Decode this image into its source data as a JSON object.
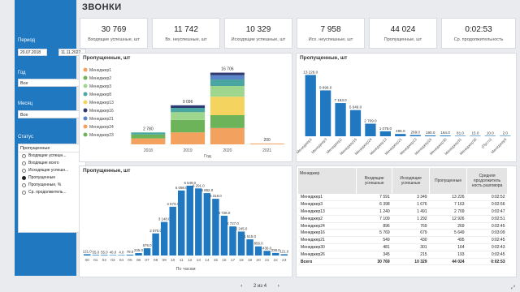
{
  "page": {
    "title": "ЗВОНКИ"
  },
  "sidebar": {
    "period_label": "Период",
    "date_from": "20.07.2018",
    "date_to": "11.11.2022",
    "year_label": "Год",
    "year_value": "Все",
    "month_label": "Месяц",
    "month_value": "Все",
    "status_label": "Статус",
    "status_value": "Пропущенные",
    "status_options": [
      {
        "label": "Входящие успешн...",
        "selected": false
      },
      {
        "label": "Входящие всего",
        "selected": false
      },
      {
        "label": "Исходящие успешн...",
        "selected": false
      },
      {
        "label": "Пропущенные",
        "selected": true
      },
      {
        "label": "Пропущенные, %",
        "selected": false
      },
      {
        "label": "Ср. продолжитель...",
        "selected": false
      }
    ]
  },
  "kpis": [
    {
      "value": "30 769",
      "label": "Входящие успешные, шт"
    },
    {
      "value": "11 742",
      "label": "Вх. неуспешные, шт"
    },
    {
      "value": "10 329",
      "label": "Исходящие успешные, шт"
    },
    {
      "value": "7 958",
      "label": "Исх. неуспешные, шт"
    },
    {
      "value": "44 024",
      "label": "Пропущенные, шт"
    },
    {
      "value": "0:02:53",
      "label": "Ср. продолжительность"
    }
  ],
  "panels": {
    "by_year_title": "Пропущенные, шт",
    "by_manager_title": "Пропущенные, шт",
    "by_hour_title": "Пропущенные, шт"
  },
  "chart_data": [
    {
      "type": "bar",
      "stacked": true,
      "categories": [
        "2018",
        "2019",
        "2020",
        "2021"
      ],
      "xlabel": "Год",
      "totals": [
        2780,
        9096,
        16706,
        200
      ],
      "legend": [
        "Менеджер1",
        "Менеджер2",
        "Менеджер3",
        "Менеджер8",
        "Менеджер13",
        "Менеджер16",
        "Менеджер21",
        "Менеджер24",
        "Менеджер23"
      ],
      "colors": {
        "orange": "#f2a25e",
        "green": "#6cb35a",
        "lightgreen": "#9ed68d",
        "teal": "#4aa6a0",
        "yellow": "#f4d35e",
        "navy": "#2f3a73",
        "blue": "#5a86c9"
      },
      "segments": {
        "2018": [
          {
            "color": "orange",
            "value": 1400
          },
          {
            "color": "green",
            "value": 900
          },
          {
            "color": "teal",
            "value": 480
          }
        ],
        "2019": [
          {
            "color": "orange",
            "value": 2800
          },
          {
            "color": "green",
            "value": 2900
          },
          {
            "color": "lightgreen",
            "value": 1800
          },
          {
            "color": "teal",
            "value": 1000
          },
          {
            "color": "navy",
            "value": 596
          }
        ],
        "2020": [
          {
            "color": "orange",
            "value": 3800
          },
          {
            "color": "green",
            "value": 3000
          },
          {
            "color": "yellow",
            "value": 4300
          },
          {
            "color": "lightgreen",
            "value": 2500
          },
          {
            "color": "teal",
            "value": 1500
          },
          {
            "color": "blue",
            "value": 1000
          },
          {
            "color": "navy",
            "value": 606
          }
        ],
        "2021": [
          {
            "color": "orange",
            "value": 200
          }
        ]
      }
    },
    {
      "type": "bar",
      "categories": [
        "Менеджер1",
        "Менеджер3",
        "Менеджер2",
        "Менеджер16",
        "Менеджер24",
        "Менеджер13",
        "Менеджер21",
        "Менеджер23",
        "Менеджер26",
        "Менеджер30",
        "Менеджер31",
        "Менеджер38",
        "(Пусто)",
        "Менеджер5"
      ],
      "values": [
        13226,
        9899,
        7163,
        5649,
        2709,
        1078,
        495,
        269,
        190,
        164,
        81,
        15,
        10,
        2
      ],
      "labels": [
        "13 226.0",
        "9 899.0",
        "7 163.0",
        "5 649.0",
        "2 709.0",
        "1 078.0",
        "495.0",
        "269.0",
        "190.0",
        "164.0",
        "81.0",
        "15.0",
        "10.0",
        "2.0"
      ],
      "ylim": [
        0,
        14000
      ]
    },
    {
      "type": "bar",
      "categories": [
        "00",
        "01",
        "02",
        "03",
        "04",
        "05",
        "06",
        "07",
        "08",
        "09",
        "10",
        "11",
        "12",
        "13",
        "14",
        "15",
        "16",
        "17",
        "18",
        "19",
        "20",
        "21",
        "22",
        "23"
      ],
      "values": [
        121,
        55,
        55,
        40,
        4,
        79,
        225,
        676,
        2070,
        3148,
        4573,
        6098,
        6549,
        6291,
        5852,
        5318,
        3728,
        2727,
        2245,
        1515,
        856,
        436,
        238,
        121
      ],
      "labels": [
        "121.0",
        "55.0",
        "55.0",
        "40.0",
        "4.0",
        "79.0",
        "225.0",
        "676.0",
        "2 070.0",
        "3 148.0",
        "4 573.0",
        "6 098.0",
        "6 549.0",
        "6 291.0",
        "5 852.0",
        "5 318.0",
        "3 728.0",
        "2 727.0",
        "2 245.0",
        "1 515.0",
        "856.0",
        "436.0",
        "238.0",
        "121.0"
      ],
      "xlabel": "По часам",
      "ylim": [
        0,
        7000
      ]
    }
  ],
  "table": {
    "headers": [
      "Менеджер",
      "Входящие успешные",
      "Исходящие успешные",
      "Пропущенные",
      "Средняя продолжитель ность разговора"
    ],
    "rows": [
      [
        "Менеджер1",
        "7 591",
        "3 349",
        "13 226",
        "0:02:52"
      ],
      [
        "Менеджер3",
        "6 398",
        "1 676",
        "7 163",
        "0:02:56"
      ],
      [
        "Менеджер13",
        "1 240",
        "1 491",
        "2 709",
        "0:02:47"
      ],
      [
        "Менеджер2",
        "7 109",
        "1 292",
        "12 926",
        "0:02:51"
      ],
      [
        "Менеджер24",
        "896",
        "769",
        "269",
        "0:02:45"
      ],
      [
        "Менеджер16",
        "5 769",
        "679",
        "5 649",
        "0:03:09"
      ],
      [
        "Менеджер21",
        "549",
        "430",
        "495",
        "0:02:45"
      ],
      [
        "Менеджер30",
        "481",
        "301",
        "164",
        "0:02:43"
      ],
      [
        "Менеджер26",
        "345",
        "215",
        "193",
        "0:02:45"
      ]
    ],
    "total": [
      "Всего",
      "30 769",
      "10 329",
      "44 024",
      "0:02:53"
    ]
  },
  "pager": {
    "prev": "‹",
    "text": "2 из 4",
    "next": "›"
  }
}
